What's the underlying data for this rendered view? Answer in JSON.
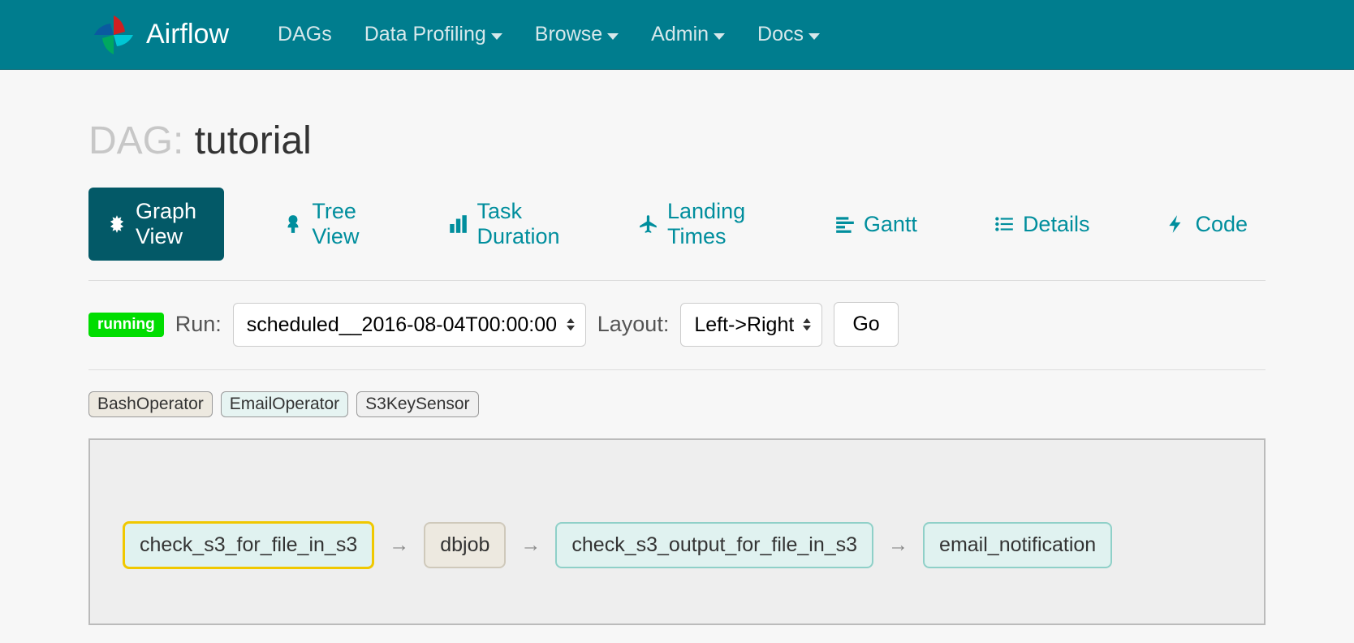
{
  "nav": {
    "brand": "Airflow",
    "items": [
      "DAGs",
      "Data Profiling",
      "Browse",
      "Admin",
      "Docs"
    ],
    "dropdowns": [
      false,
      true,
      true,
      true,
      true
    ]
  },
  "page": {
    "title_prefix": "DAG: ",
    "title_name": "tutorial"
  },
  "tabs": {
    "graph": "Graph View",
    "tree": "Tree View",
    "duration": "Task Duration",
    "landing": "Landing Times",
    "gantt": "Gantt",
    "details": "Details",
    "code": "Code"
  },
  "filters": {
    "status": "running",
    "run_label": "Run:",
    "run_value": "scheduled__2016-08-04T00:00:00",
    "layout_label": "Layout:",
    "layout_value": "Left->Right",
    "go": "Go"
  },
  "legend": {
    "bash": "BashOperator",
    "email": "EmailOperator",
    "s3": "S3KeySensor"
  },
  "graph": {
    "nodes": [
      {
        "id": "check_s3_for_file_in_s3",
        "type": "s3",
        "highlight": true
      },
      {
        "id": "dbjob",
        "type": "bash",
        "highlight": false
      },
      {
        "id": "check_s3_output_for_file_in_s3",
        "type": "s3",
        "highlight": false
      },
      {
        "id": "email_notification",
        "type": "email",
        "highlight": false
      }
    ]
  }
}
